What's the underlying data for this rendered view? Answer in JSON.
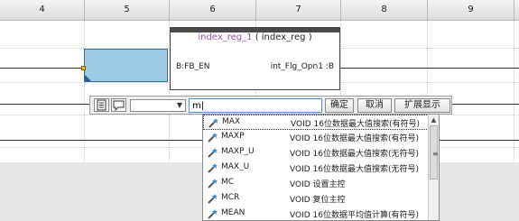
{
  "columns": [
    "4",
    "5",
    "6",
    "7",
    "8",
    "9"
  ],
  "function_block": {
    "instance_name": "index_reg_1",
    "type_name": "( index_reg )",
    "input_label": "B:FB_EN",
    "output_label": "int_Flg_Opn1 :B"
  },
  "toolbar": {
    "combo_value": "",
    "input_value": "m|",
    "confirm_label": "确定",
    "cancel_label": "取消",
    "expand_label": "扩展显示"
  },
  "autocomplete": {
    "items": [
      {
        "name": "MAX",
        "desc": "VOID 16位数据最大值搜索(有符号)"
      },
      {
        "name": "MAXP",
        "desc": "VOID 16位数据最大值搜索(有符号)"
      },
      {
        "name": "MAXP_U",
        "desc": "VOID 16位数据最大值搜索(无符号)"
      },
      {
        "name": "MAX_U",
        "desc": "VOID 16位数据最大值搜索(无符号)"
      },
      {
        "name": "MC",
        "desc": "VOID 设置主控"
      },
      {
        "name": "MCR",
        "desc": "VOID 复位主控"
      },
      {
        "name": "MEAN",
        "desc": "VOID 16位数据平均值计算(有符号)"
      }
    ]
  },
  "icons": {
    "toolbar_icon_1": "template-icon",
    "toolbar_icon_2": "comment-icon",
    "list_item_icon": "function-wand-icon"
  },
  "colors": {
    "selected_cell": "#9dcbe3",
    "instance_name": "#a050b0",
    "input_border": "#4f8fd0"
  }
}
